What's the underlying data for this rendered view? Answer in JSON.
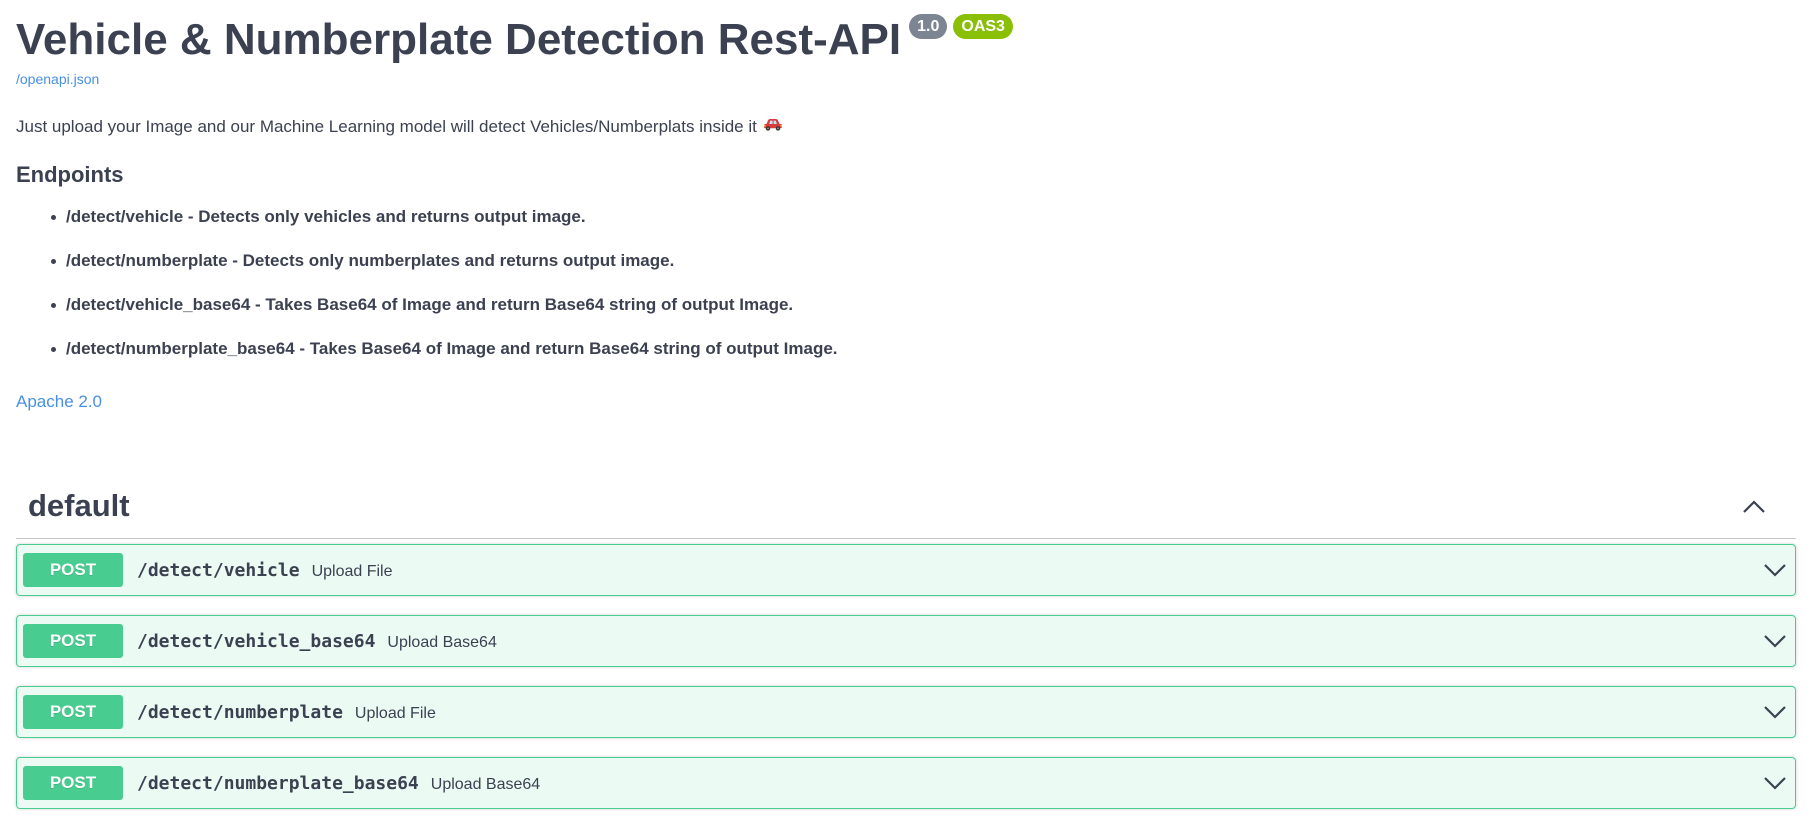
{
  "info": {
    "title": "Vehicle & Numberplate Detection Rest-API",
    "version": "1.0",
    "oas_badge": "OAS3",
    "spec_url": "/openapi.json",
    "description": "Just upload your Image and our Machine Learning model will detect Vehicles/Numberplats inside it",
    "description_icon": "car-icon",
    "endpoints_heading": "Endpoints",
    "endpoints": [
      "/detect/vehicle - Detects only vehicles and returns output image.",
      "/detect/numberplate - Detects only numberplates and returns output image.",
      "/detect/vehicle_base64 - Takes Base64 of Image and return Base64 string of output Image.",
      "/detect/numberplate_base64 - Takes Base64 of Image and return Base64 string of output Image."
    ],
    "license": "Apache 2.0"
  },
  "tag": {
    "name": "default",
    "expanded": true,
    "operations": [
      {
        "method": "POST",
        "path": "/detect/vehicle",
        "summary": "Upload File"
      },
      {
        "method": "POST",
        "path": "/detect/vehicle_base64",
        "summary": "Upload Base64"
      },
      {
        "method": "POST",
        "path": "/detect/numberplate",
        "summary": "Upload File"
      },
      {
        "method": "POST",
        "path": "/detect/numberplate_base64",
        "summary": "Upload Base64"
      }
    ]
  },
  "colors": {
    "post": "#49cc90",
    "link": "#4990e2",
    "text": "#3b4151",
    "version_badge": "#7d8492",
    "oas_badge": "#89bf04"
  }
}
